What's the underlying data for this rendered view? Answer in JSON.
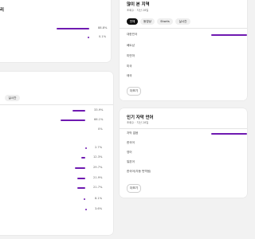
{
  "top_left_card": {
    "title_partial": "리",
    "rows": [
      {
        "pct": "88.8%"
      },
      {
        "pct": "0.1%"
      }
    ]
  },
  "mid_left_card": {
    "tabs": [
      "실시간"
    ],
    "rows_a": [
      {
        "pct": "33.9%"
      },
      {
        "pct": "66.1%"
      },
      {
        "pct": "0%"
      }
    ],
    "rows_b": [
      {
        "pct": "2.7%"
      },
      {
        "pct": "12.3%"
      },
      {
        "pct": "29.7%"
      },
      {
        "pct": "21.9%"
      },
      {
        "pct": "21.7%"
      },
      {
        "pct": "8.1%"
      },
      {
        "pct": "3.6%"
      }
    ]
  },
  "regions_card": {
    "title": "많이 본 지역",
    "subtitle": "조회수 · 지난 28일",
    "tabs": [
      {
        "label": "전체",
        "active": true
      },
      {
        "label": "동영상",
        "active": false
      },
      {
        "label": "Shorts",
        "active": false
      },
      {
        "label": "실시간",
        "active": false
      }
    ],
    "rows": [
      "대한민국",
      "베트남",
      "미얀마",
      "미국",
      "태국",
      "대만"
    ],
    "more_label": "더보기"
  },
  "subtitles_card": {
    "title": "인기 자막 언어",
    "subtitle": "조회수 · 지난 28일",
    "rows": [
      "자막 없음",
      "한국어",
      "영어",
      "일본어",
      "한국어(자동 번역됨)"
    ],
    "more_label": "더보기"
  },
  "colors": {
    "accent": "#6f1ab1",
    "background": "#f2f2f2",
    "card": "#ffffff"
  }
}
